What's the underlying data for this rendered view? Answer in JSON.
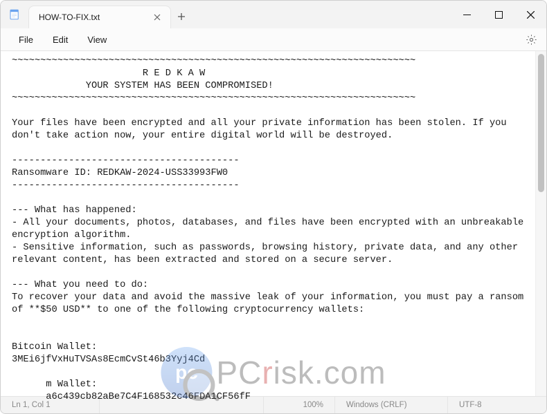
{
  "titlebar": {
    "tab_title": "HOW-TO-FIX.txt"
  },
  "menubar": {
    "file": "File",
    "edit": "Edit",
    "view": "View"
  },
  "document": {
    "sep1": "~~~~~~~~~~~~~~~~~~~~~~~~~~~~~~~~~~~~~~~~~~~~~~~~~~~~~~~~~~~~~~~~~~~~~~~",
    "header_name": "                       R E D K A W",
    "header_compromised": "             YOUR SYSTEM HAS BEEN COMPROMISED!",
    "sep2": "~~~~~~~~~~~~~~~~~~~~~~~~~~~~~~~~~~~~~~~~~~~~~~~~~~~~~~~~~~~~~~~~~~~~~~~",
    "intro": "Your files have been encrypted and all your private information has been stolen. If you don't take action now, your entire digital world will be destroyed.",
    "dash1": "----------------------------------------",
    "ransom_id": "Ransomware ID: REDKAW-2024-USS33993FW0",
    "dash2": "----------------------------------------",
    "what_happened_title": "--- What has happened:",
    "what_happened_1": "- All your documents, photos, databases, and files have been encrypted with an unbreakable encryption algorithm.",
    "what_happened_2": "- Sensitive information, such as passwords, browsing history, private data, and any other relevant content, has been extracted and stored on a secure server.",
    "what_need_title": "--- What you need to do:",
    "what_need_body": "To recover your data and avoid the massive leak of your information, you must pay a ransom of **$50 USD** to one of the following cryptocurrency wallets:",
    "btc_label": "Bitcoin Wallet:",
    "btc_addr": "3MEi6jfVxHuTVSAs8EcmCvSt46b3Yyj4Cd",
    "eth_label": "      m Wallet:",
    "eth_addr": "      a6c439cb82aBe7C4F168532c46FDA1CF56fF"
  },
  "statusbar": {
    "position": "Ln 1, Col 1",
    "zoom": "100%",
    "line_ending": "Windows (CRLF)",
    "encoding": "UTF-8"
  },
  "watermark": {
    "badge": "pc",
    "text_plain": "PC",
    "text_r": "r",
    "text_rest": "isk.com"
  }
}
